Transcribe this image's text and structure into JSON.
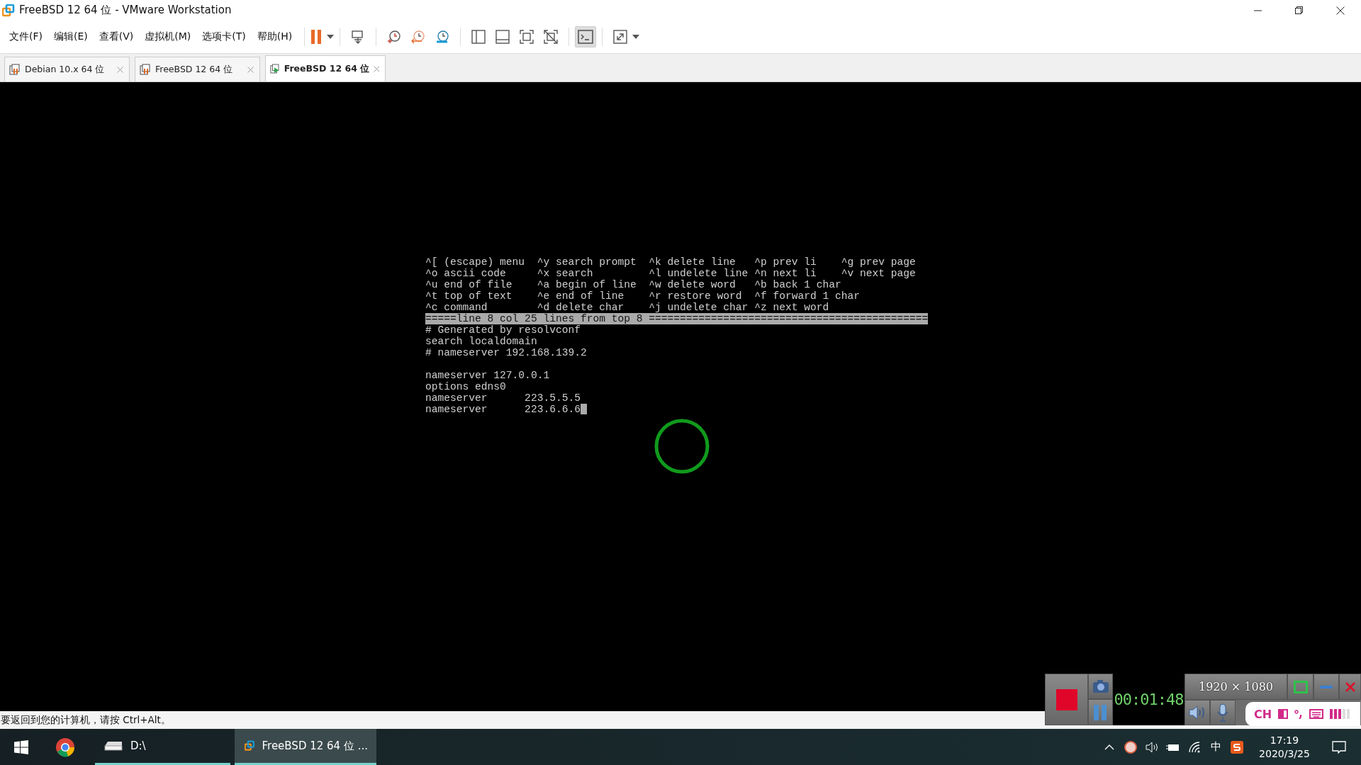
{
  "window": {
    "title": "FreeBSD 12 64 位 - VMware Workstation"
  },
  "menu": [
    "文件(F)",
    "编辑(E)",
    "查看(V)",
    "虚拟机(M)",
    "选项卡(T)",
    "帮助(H)"
  ],
  "tabs": [
    {
      "label": "Debian 10.x 64 位",
      "selected": false,
      "running": false
    },
    {
      "label": "FreeBSD 12 64 位",
      "selected": false,
      "running": false
    },
    {
      "label": "FreeBSD 12 64 位",
      "selected": true,
      "running": true
    }
  ],
  "terminal": {
    "menu_rows": [
      [
        "^[ (escape) menu",
        "^y search prompt",
        "^k delete line",
        "^p prev li",
        "^g prev page"
      ],
      [
        "^o ascii code",
        "^x search",
        "^l undelete line",
        "^n next li",
        "^v next page"
      ],
      [
        "^u end of file",
        "^a begin of line",
        "^w delete word",
        "^b back 1 char"
      ],
      [
        "^t top of text",
        "^e end of line",
        "^r restore word",
        "^f forward 1 char"
      ],
      [
        "^c command",
        "^d delete char",
        "^j undelete char",
        "^z next word"
      ]
    ],
    "status_line": "=====line 8 col 25 lines from top 8 =============================================",
    "lines": [
      {
        "kind": "text",
        "text": "# Generated by resolvconf",
        "cursor": false
      },
      {
        "kind": "text",
        "text": "search localdomain",
        "cursor": false
      },
      {
        "kind": "text",
        "text": "# nameserver 192.168.139.2",
        "cursor": false
      },
      {
        "kind": "blank"
      },
      {
        "kind": "text",
        "text": "nameserver 127.0.0.1",
        "cursor": false
      },
      {
        "kind": "text",
        "text": "options edns0",
        "cursor": false
      },
      {
        "kind": "text",
        "text": "nameserver      223.5.5.5",
        "cursor": false
      },
      {
        "kind": "text",
        "text": "nameserver      223.6.6.6",
        "cursor": true
      }
    ]
  },
  "status_bar": "要返回到您的计算机，请按 Ctrl+Alt。",
  "recorder": {
    "timer": "00:01:48",
    "resolution": "1920 × 1080"
  },
  "ime_bar": {
    "mode": "CH"
  },
  "taskbar": {
    "items": [
      {
        "kind": "drive",
        "label": "D:\\",
        "selected": false
      },
      {
        "kind": "vmware",
        "label": "FreeBSD 12 64 位 ...",
        "selected": true
      }
    ],
    "tray_ime": "中",
    "time": "17:19",
    "date": "2020/3/25"
  }
}
